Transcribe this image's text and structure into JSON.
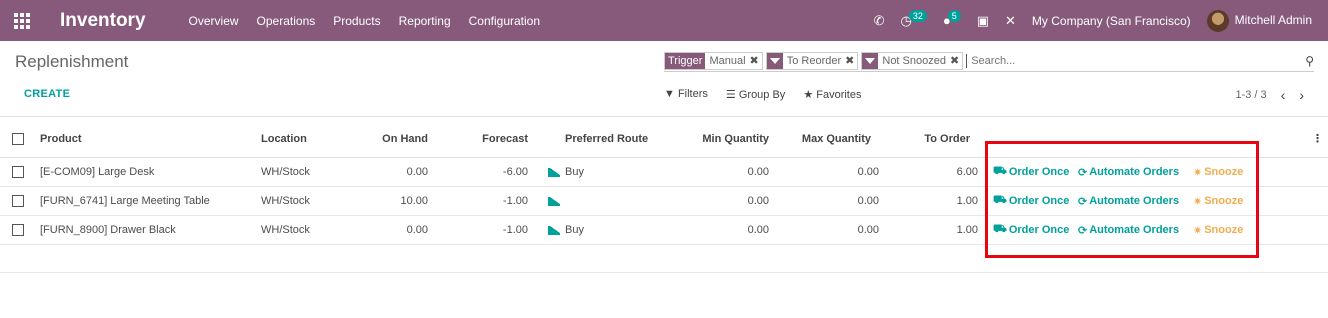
{
  "app": {
    "name": "Inventory"
  },
  "nav": {
    "items": [
      "Overview",
      "Operations",
      "Products",
      "Reporting",
      "Configuration"
    ]
  },
  "systray": {
    "activity_count": "32",
    "message_count": "5",
    "company": "My Company (San Francisco)",
    "user": "Mitchell Admin"
  },
  "page": {
    "title": "Replenishment",
    "create_label": "CREATE"
  },
  "search": {
    "facets": [
      {
        "label": "Trigger",
        "value": "Manual"
      },
      {
        "label": "filter-icon",
        "value": "To Reorder"
      },
      {
        "label": "filter-icon",
        "value": "Not Snoozed"
      }
    ],
    "placeholder": "Search..."
  },
  "filters": {
    "filters_label": "Filters",
    "groupby_label": "Group By",
    "favorites_label": "Favorites"
  },
  "pager": {
    "value": "1-3 / 3"
  },
  "table": {
    "headers": {
      "product": "Product",
      "location": "Location",
      "on_hand": "On Hand",
      "forecast": "Forecast",
      "route": "Preferred Route",
      "min_qty": "Min Quantity",
      "max_qty": "Max Quantity",
      "to_order": "To Order"
    },
    "rows": [
      {
        "product": "[E-COM09] Large Desk",
        "location": "WH/Stock",
        "on_hand": "0.00",
        "forecast": "-6.00",
        "route": "Buy",
        "min_qty": "0.00",
        "max_qty": "0.00",
        "to_order": "6.00"
      },
      {
        "product": "[FURN_6741] Large Meeting Table",
        "location": "WH/Stock",
        "on_hand": "10.00",
        "forecast": "-1.00",
        "route": "",
        "min_qty": "0.00",
        "max_qty": "0.00",
        "to_order": "1.00"
      },
      {
        "product": "[FURN_8900] Drawer Black",
        "location": "WH/Stock",
        "on_hand": "0.00",
        "forecast": "-1.00",
        "route": "Buy",
        "min_qty": "0.00",
        "max_qty": "0.00",
        "to_order": "1.00"
      }
    ],
    "actions": {
      "order_once": "Order Once",
      "automate": "Automate Orders",
      "snooze": "Snooze"
    }
  },
  "colors": {
    "brand": "#875a7b",
    "accent": "#00a09d",
    "snooze": "#f0ad4e",
    "highlight": "#e8050f"
  }
}
